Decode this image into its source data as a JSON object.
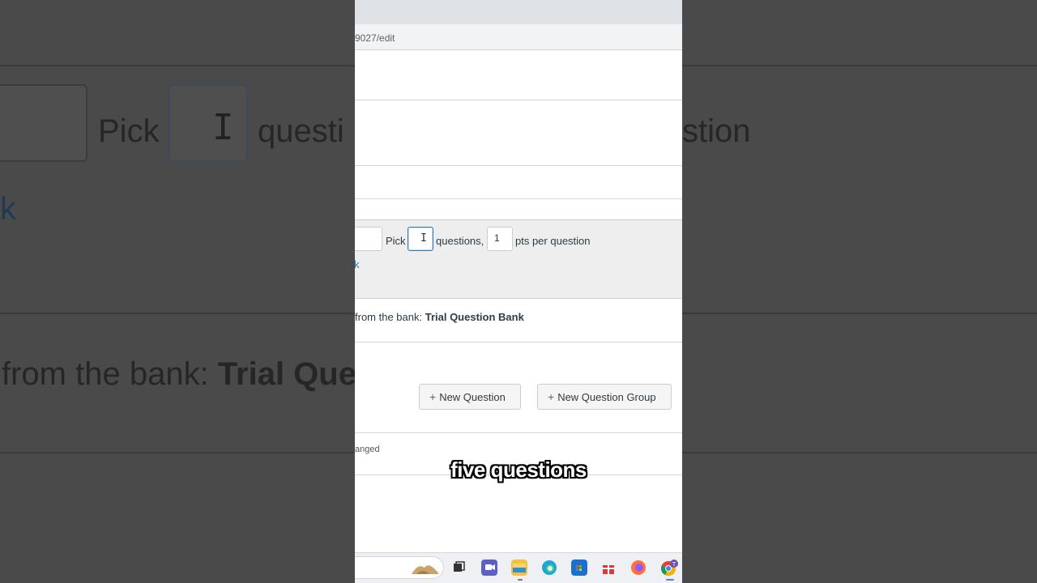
{
  "browser": {
    "url_fragment": "9027/edit"
  },
  "question_group": {
    "pick_label": "Pick",
    "pick_value": "",
    "questions_label": "questions,",
    "points_value": "1",
    "pts_label": "pts per question",
    "link_fragment": "k"
  },
  "bank": {
    "prefix": "from the bank: ",
    "name": "Trial Question Bank"
  },
  "buttons": {
    "new_question": "New Question",
    "new_question_group": "New Question Group"
  },
  "status_fragment": "anged",
  "caption": "five questions",
  "background_zoom": {
    "pick": "Pick",
    "questions_fragment": "questi",
    "question_fragment": "stion",
    "link_fragment": "k",
    "bank_prefix": "from the bank: ",
    "bank_fragment": "Trial Que"
  },
  "taskbar": {
    "icons": [
      "photos-icon",
      "task-view-icon",
      "chat-icon",
      "file-explorer-icon",
      "edge-icon",
      "store-icon",
      "gift-icon",
      "firefox-icon",
      "chrome-icon"
    ],
    "chrome_badge": "T"
  }
}
